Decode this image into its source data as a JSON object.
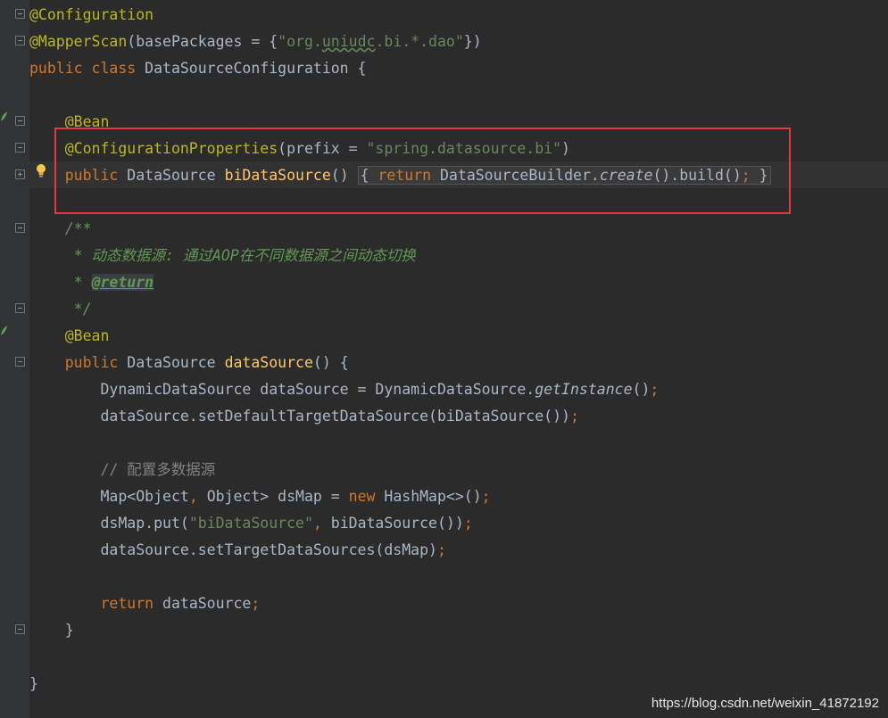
{
  "editor": {
    "lines": [
      {
        "id": "l1",
        "parts": [
          {
            "c": "ann",
            "t": "@Configuration"
          }
        ]
      },
      {
        "id": "l2",
        "parts": [
          {
            "c": "ann",
            "t": "@MapperScan"
          },
          {
            "c": "plain",
            "t": "(basePackages = {"
          },
          {
            "c": "str",
            "t": "\"org."
          },
          {
            "c": "strpkg",
            "t": "uniudc"
          },
          {
            "c": "str",
            "t": ".bi.*.dao\""
          },
          {
            "c": "plain",
            "t": "})"
          }
        ]
      },
      {
        "id": "l3",
        "parts": [
          {
            "c": "kw",
            "t": "public class "
          },
          {
            "c": "plain",
            "t": "DataSourceConfiguration {"
          }
        ]
      },
      {
        "id": "l5",
        "parts": [
          {
            "c": "ann",
            "t": "    @Bean"
          }
        ]
      },
      {
        "id": "l6",
        "parts": [
          {
            "c": "ann",
            "t": "    @ConfigurationProperties"
          },
          {
            "c": "plain",
            "t": "(prefix = "
          },
          {
            "c": "str",
            "t": "\"spring.datasource.bi\""
          },
          {
            "c": "plain",
            "t": ")"
          }
        ]
      },
      {
        "id": "l7",
        "parts": [
          {
            "c": "kw",
            "t": "    public "
          },
          {
            "c": "plain",
            "t": "DataSource "
          },
          {
            "c": "fn",
            "t": "biDataSource"
          },
          {
            "c": "plain",
            "t": "() "
          },
          {
            "c": "foldstart",
            "t": "{ "
          },
          {
            "c": "kw2",
            "t": "return "
          },
          {
            "c": "plain2",
            "t": "DataSourceBuilder."
          },
          {
            "c": "static2",
            "t": "create"
          },
          {
            "c": "plain2",
            "t": "().build()"
          },
          {
            "c": "kw2",
            "t": ";"
          },
          {
            "c": "foldend",
            "t": " }"
          }
        ]
      },
      {
        "id": "l9",
        "parts": [
          {
            "c": "doc",
            "t": "    /**"
          }
        ]
      },
      {
        "id": "l10",
        "parts": [
          {
            "c": "doc",
            "t": "     * 动态数据源: 通过AOP在不同数据源之间动态切换"
          }
        ]
      },
      {
        "id": "l11",
        "parts": [
          {
            "c": "doc",
            "t": "     * "
          },
          {
            "c": "doctag",
            "t": "@return"
          }
        ]
      },
      {
        "id": "l12",
        "parts": [
          {
            "c": "doc",
            "t": "     */"
          }
        ]
      },
      {
        "id": "l13",
        "parts": [
          {
            "c": "ann",
            "t": "    @Bean"
          }
        ]
      },
      {
        "id": "l14",
        "parts": [
          {
            "c": "kw",
            "t": "    public "
          },
          {
            "c": "plain",
            "t": "DataSource "
          },
          {
            "c": "fn",
            "t": "dataSource"
          },
          {
            "c": "plain",
            "t": "() {"
          }
        ]
      },
      {
        "id": "l15",
        "parts": [
          {
            "c": "plain",
            "t": "        DynamicDataSource dataSource = DynamicDataSource."
          },
          {
            "c": "static",
            "t": "getInstance"
          },
          {
            "c": "plain",
            "t": "()"
          },
          {
            "c": "kw",
            "t": ";"
          }
        ]
      },
      {
        "id": "l16",
        "parts": [
          {
            "c": "plain",
            "t": "        dataSource.setDefaultTargetDataSource(biDataSource())"
          },
          {
            "c": "kw",
            "t": ";"
          }
        ]
      },
      {
        "id": "l18",
        "parts": [
          {
            "c": "cmt",
            "t": "        // 配置多数据源"
          }
        ]
      },
      {
        "id": "l19",
        "parts": [
          {
            "c": "plain",
            "t": "        Map<Object"
          },
          {
            "c": "kw",
            "t": ", "
          },
          {
            "c": "plain",
            "t": "Object> dsMap = "
          },
          {
            "c": "kw",
            "t": "new "
          },
          {
            "c": "plain",
            "t": "HashMap<>()"
          },
          {
            "c": "kw",
            "t": ";"
          }
        ]
      },
      {
        "id": "l20",
        "parts": [
          {
            "c": "plain",
            "t": "        dsMap.put("
          },
          {
            "c": "str",
            "t": "\"biDataSource\""
          },
          {
            "c": "kw",
            "t": ", "
          },
          {
            "c": "plain",
            "t": "biDataSource())"
          },
          {
            "c": "kw",
            "t": ";"
          }
        ]
      },
      {
        "id": "l21",
        "parts": [
          {
            "c": "plain",
            "t": "        dataSource.setTargetDataSources(dsMap)"
          },
          {
            "c": "kw",
            "t": ";"
          }
        ]
      },
      {
        "id": "l23",
        "parts": [
          {
            "c": "kw",
            "t": "        return "
          },
          {
            "c": "plain",
            "t": "dataSource"
          },
          {
            "c": "kw",
            "t": ";"
          }
        ]
      },
      {
        "id": "l24",
        "parts": [
          {
            "c": "plain",
            "t": "    }"
          }
        ]
      },
      {
        "id": "l26",
        "parts": [
          {
            "c": "plain",
            "t": "}"
          }
        ]
      }
    ]
  },
  "watermark": "https://blog.csdn.net/weixin_41872192",
  "colors": {
    "background": "#2b2b2b",
    "gutter": "#313335",
    "annotation": "#bbb529",
    "keyword": "#cc7832",
    "string": "#6a8759",
    "method": "#ffc66d",
    "doc": "#629755",
    "comment": "#808080",
    "text": "#a9b7c6",
    "highlight_box": "#e03c3c"
  },
  "icons": [
    "fold-marker-icon",
    "bean-gutter-icon",
    "lightbulb-icon"
  ]
}
